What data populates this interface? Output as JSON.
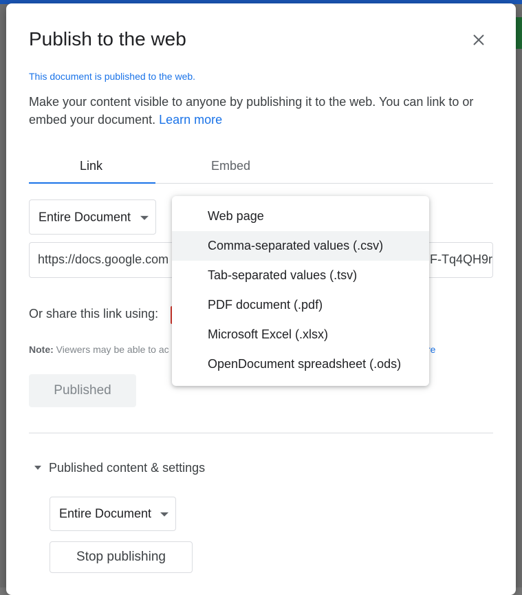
{
  "dialog": {
    "title": "Publish to the web",
    "status": "This document is published to the web.",
    "description": "Make your content visible to anyone by publishing it to the web. You can link to or embed your document.",
    "learn_more": "Learn more"
  },
  "tabs": [
    {
      "label": "Link",
      "active": true
    },
    {
      "label": "Embed",
      "active": false
    }
  ],
  "link": {
    "scope_select": "Entire Document",
    "url_visible_start": "https://docs.google.com",
    "url_visible_end": "F-Tq4QH9r",
    "share_label": "Or share this link using:",
    "note_bold": "Note:",
    "note_text": "Viewers may be able to ac",
    "note_link_fragment": "re",
    "published_button": "Published"
  },
  "format_menu": {
    "items": [
      {
        "label": "Web page"
      },
      {
        "label": "Comma-separated values (.csv)",
        "highlighted": true
      },
      {
        "label": "Tab-separated values (.tsv)"
      },
      {
        "label": "PDF document (.pdf)"
      },
      {
        "label": "Microsoft Excel (.xlsx)"
      },
      {
        "label": "OpenDocument spreadsheet (.ods)"
      }
    ]
  },
  "settings": {
    "section_label": "Published content & settings",
    "scope_select": "Entire Document",
    "stop_button": "Stop publishing"
  },
  "icons": {
    "close": "close-icon",
    "dropdown": "chevron-down-icon"
  },
  "colors": {
    "accent": "#1a73e8",
    "menu_highlight": "#f1f3f4"
  }
}
